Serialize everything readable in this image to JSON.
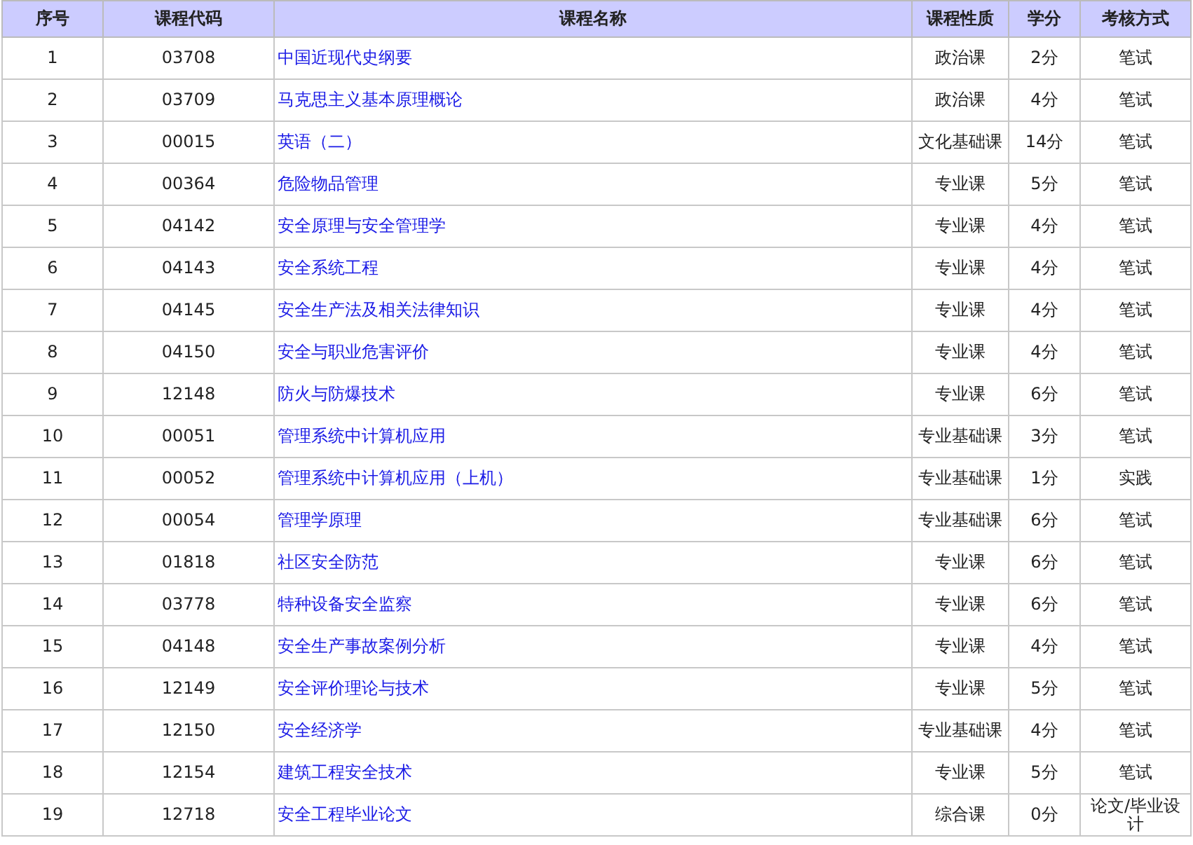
{
  "table": {
    "columns": [
      "序号",
      "课程代码",
      "课程名称",
      "课程性质",
      "学分",
      "考核方式"
    ],
    "rows": [
      [
        "1",
        "03708",
        "中国近现代史纲要",
        "政治课",
        "2分",
        "笔试"
      ],
      [
        "2",
        "03709",
        "马克思主义基本原理概论",
        "政治课",
        "4分",
        "笔试"
      ],
      [
        "3",
        "00015",
        "英语（二）",
        "文化基础课",
        "14分",
        "笔试"
      ],
      [
        "4",
        "00364",
        "危险物品管理",
        "专业课",
        "5分",
        "笔试"
      ],
      [
        "5",
        "04142",
        "安全原理与安全管理学",
        "专业课",
        "4分",
        "笔试"
      ],
      [
        "6",
        "04143",
        "安全系统工程",
        "专业课",
        "4分",
        "笔试"
      ],
      [
        "7",
        "04145",
        "安全生产法及相关法律知识",
        "专业课",
        "4分",
        "笔试"
      ],
      [
        "8",
        "04150",
        "安全与职业危害评价",
        "专业课",
        "4分",
        "笔试"
      ],
      [
        "9",
        "12148",
        "防火与防爆技术",
        "专业课",
        "6分",
        "笔试"
      ],
      [
        "10",
        "00051",
        "管理系统中计算机应用",
        "专业基础课",
        "3分",
        "笔试"
      ],
      [
        "11",
        "00052",
        "管理系统中计算机应用（上机）",
        "专业基础课",
        "1分",
        "实践"
      ],
      [
        "12",
        "00054",
        "管理学原理",
        "专业基础课",
        "6分",
        "笔试"
      ],
      [
        "13",
        "01818",
        "社区安全防范",
        "专业课",
        "6分",
        "笔试"
      ],
      [
        "14",
        "03778",
        "特种设备安全监察",
        "专业课",
        "6分",
        "笔试"
      ],
      [
        "15",
        "04148",
        "安全生产事故案例分析",
        "专业课",
        "4分",
        "笔试"
      ],
      [
        "16",
        "12149",
        "安全评价理论与技术",
        "专业课",
        "5分",
        "笔试"
      ],
      [
        "17",
        "12150",
        "安全经济学",
        "专业基础课",
        "4分",
        "笔试"
      ],
      [
        "18",
        "12154",
        "建筑工程安全技术",
        "专业课",
        "5分",
        "笔试"
      ],
      [
        "19",
        "12718",
        "安全工程毕业论文",
        "综合课",
        "0分",
        "论文/毕业设计"
      ]
    ]
  }
}
